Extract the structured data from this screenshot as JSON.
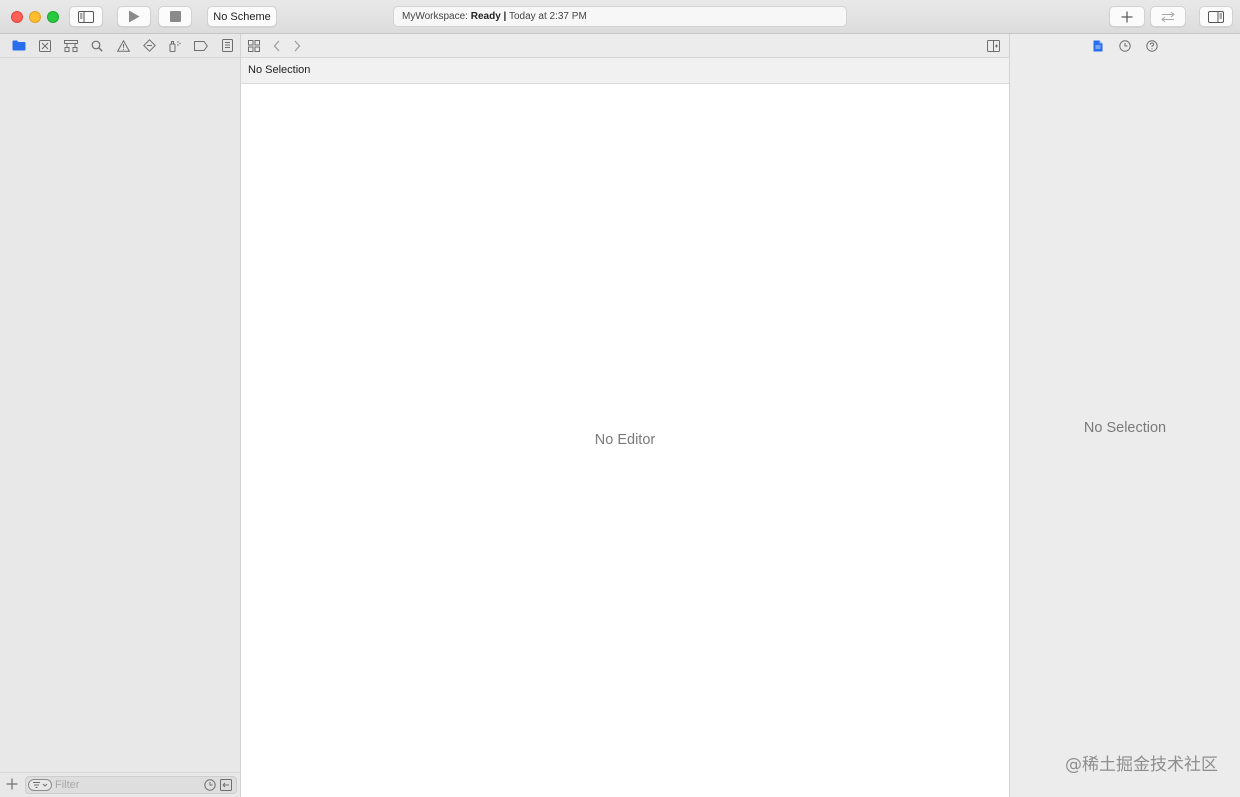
{
  "toolbar": {
    "scheme_label": "No Scheme",
    "activity": {
      "workspace": "MyWorkspace:",
      "status": "Ready",
      "separator": "|",
      "time": "Today at 2:37 PM"
    }
  },
  "navigator": {
    "tabs": [
      {
        "name": "project-navigator-icon",
        "active": true
      },
      {
        "name": "source-control-navigator-icon"
      },
      {
        "name": "symbol-navigator-icon"
      },
      {
        "name": "find-navigator-icon"
      },
      {
        "name": "issue-navigator-icon"
      },
      {
        "name": "test-navigator-icon"
      },
      {
        "name": "debug-navigator-icon"
      },
      {
        "name": "breakpoint-navigator-icon"
      },
      {
        "name": "report-navigator-icon"
      }
    ],
    "filter_placeholder": "Filter"
  },
  "editor": {
    "jump_bar_text": "No Selection",
    "empty_text": "No Editor"
  },
  "inspector": {
    "empty_text": "No Selection"
  },
  "watermark": "@稀土掘金技术社区",
  "colors": {
    "accent": "#2a6ef0",
    "icon": "#6e6e6e"
  }
}
